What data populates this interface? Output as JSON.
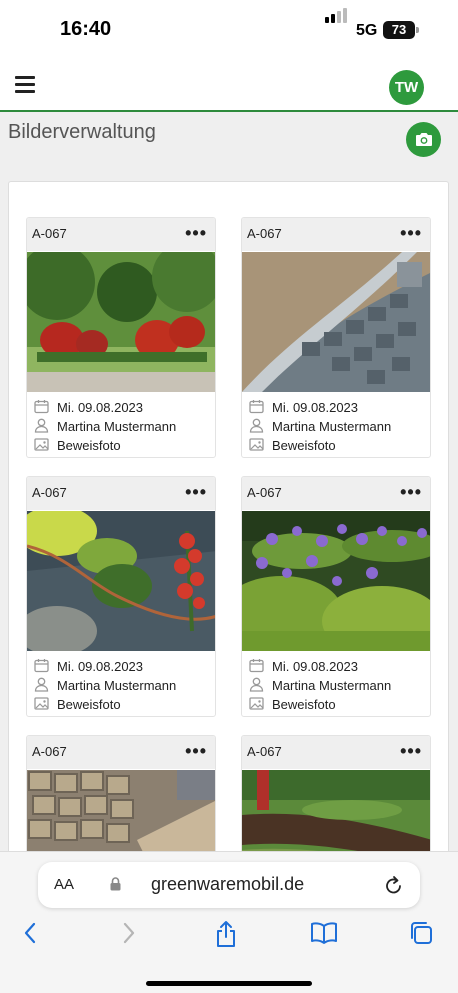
{
  "status": {
    "time": "16:40",
    "network": "5G",
    "battery": "73"
  },
  "header": {
    "avatar_initials": "TW",
    "accent_color": "#2e9a3d"
  },
  "page": {
    "title": "Bilderverwaltung"
  },
  "cards": [
    {
      "id": "A-067",
      "date": "Mi. 09.08.2023",
      "user": "Martina Mustermann",
      "type": "Beweisfoto",
      "image": "topiary-garden"
    },
    {
      "id": "A-067",
      "date": "Mi. 09.08.2023",
      "user": "Martina Mustermann",
      "type": "Beweisfoto",
      "image": "paving-stones-curve"
    },
    {
      "id": "A-067",
      "date": "Mi. 09.08.2023",
      "user": "Martina Mustermann",
      "type": "Beweisfoto",
      "image": "drip-irrigation-bed"
    },
    {
      "id": "A-067",
      "date": "Mi. 09.08.2023",
      "user": "Martina Mustermann",
      "type": "Beweisfoto",
      "image": "allium-hedges"
    },
    {
      "id": "A-067",
      "date": "",
      "user": "",
      "type": "",
      "image": "cobblestones"
    },
    {
      "id": "A-067",
      "date": "",
      "user": "",
      "type": "",
      "image": "soil-trench"
    }
  ],
  "card_menu_label": "•••",
  "browser": {
    "aa_label": "AA",
    "url": "greenwaremobil.de"
  }
}
